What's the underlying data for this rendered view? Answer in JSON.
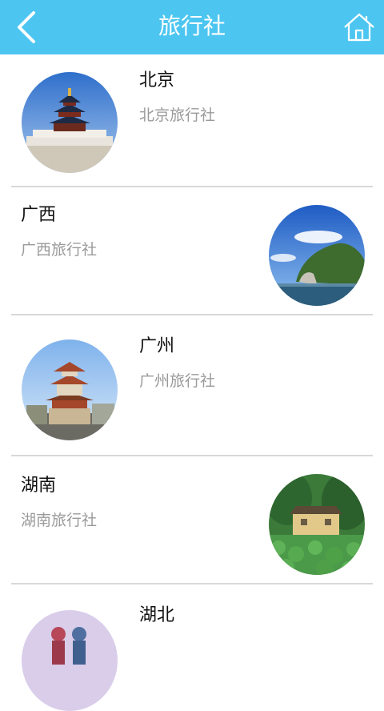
{
  "header": {
    "title": "旅行社",
    "back_icon": "chevron-left-icon",
    "home_icon": "home-icon",
    "bg_color": "#4cc6f1"
  },
  "list": {
    "items": [
      {
        "name": "北京",
        "sub": "北京旅行社"
      },
      {
        "name": "广西",
        "sub": "广西旅行社"
      },
      {
        "name": "广州",
        "sub": "广州旅行社"
      },
      {
        "name": "湖南",
        "sub": "湖南旅行社"
      },
      {
        "name": "湖北"
      }
    ]
  }
}
